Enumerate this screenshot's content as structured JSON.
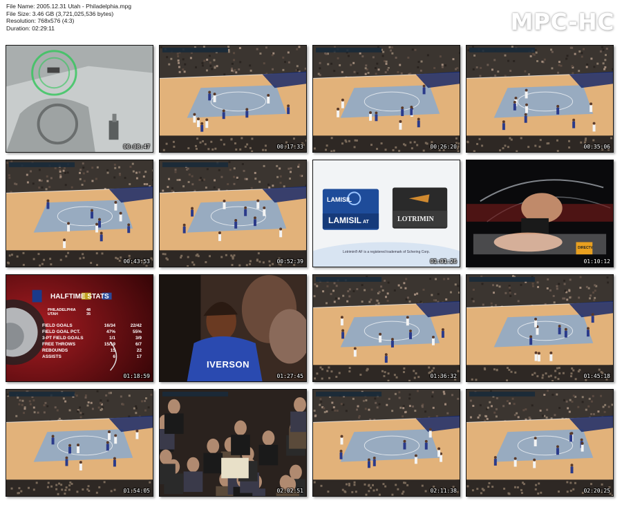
{
  "file_info": {
    "name": "File Name: 2005.12.31 Utah - Philadelphia.mpg",
    "size": "File Size: 3.46 GB (3,721,025,536 bytes)",
    "resolution": "Resolution: 768x576 (4:3)",
    "duration": "Duration: 02:29:11"
  },
  "logo": "MPC-HC",
  "thumbnails": [
    {
      "timestamp": "00:08:47",
      "scene": "car-interior"
    },
    {
      "timestamp": "00:17:33",
      "scene": "court"
    },
    {
      "timestamp": "00:26:20",
      "scene": "court"
    },
    {
      "timestamp": "00:35:06",
      "scene": "court"
    },
    {
      "timestamp": "00:43:53",
      "scene": "court"
    },
    {
      "timestamp": "00:52:39",
      "scene": "court"
    },
    {
      "timestamp": "01:01:26",
      "scene": "ad-lamisil"
    },
    {
      "timestamp": "01:10:12",
      "scene": "boxing"
    },
    {
      "timestamp": "01:18:59",
      "scene": "halftime-stats"
    },
    {
      "timestamp": "01:27:45",
      "scene": "player-closeup"
    },
    {
      "timestamp": "01:36:32",
      "scene": "court"
    },
    {
      "timestamp": "01:45:18",
      "scene": "court"
    },
    {
      "timestamp": "01:54:05",
      "scene": "court"
    },
    {
      "timestamp": "02:02:51",
      "scene": "crowd"
    },
    {
      "timestamp": "02:11:38",
      "scene": "court"
    },
    {
      "timestamp": "02:20:25",
      "scene": "court"
    }
  ],
  "ad": {
    "brand1": "LAMISIL",
    "brand1_sub": "AT",
    "brand2": "LOTRIMIN",
    "footer": "Lotrimin® AF is a registered trademark of Schering Corp."
  },
  "boxing": {
    "channel_badge": "DIRECTV"
  },
  "halftime": {
    "title": "HALFTIME STATS",
    "team1": "PHILADELPHIA",
    "team1_score": "48",
    "team2": "UTAH",
    "team2_score": "35",
    "rows": [
      {
        "label": "FIELD GOALS",
        "a": "16/34",
        "b": "22/42"
      },
      {
        "label": "FIELD GOAL PCT.",
        "a": "47%",
        "b": "55%"
      },
      {
        "label": "3-PT FIELD GOALS",
        "a": "1/1",
        "b": "3/9"
      },
      {
        "label": "FREE THROWS",
        "a": "15/19",
        "b": "6/7"
      },
      {
        "label": "REBOUNDS",
        "a": "15",
        "b": "22"
      },
      {
        "label": "ASSISTS",
        "a": "6",
        "b": "17"
      }
    ]
  },
  "player": {
    "jersey": "IVERSON"
  },
  "colors": {
    "court": "#e2b27a",
    "paint": "#7fa8d8",
    "stands": "#3b3530",
    "halftime_bg": "#6a0e12"
  }
}
